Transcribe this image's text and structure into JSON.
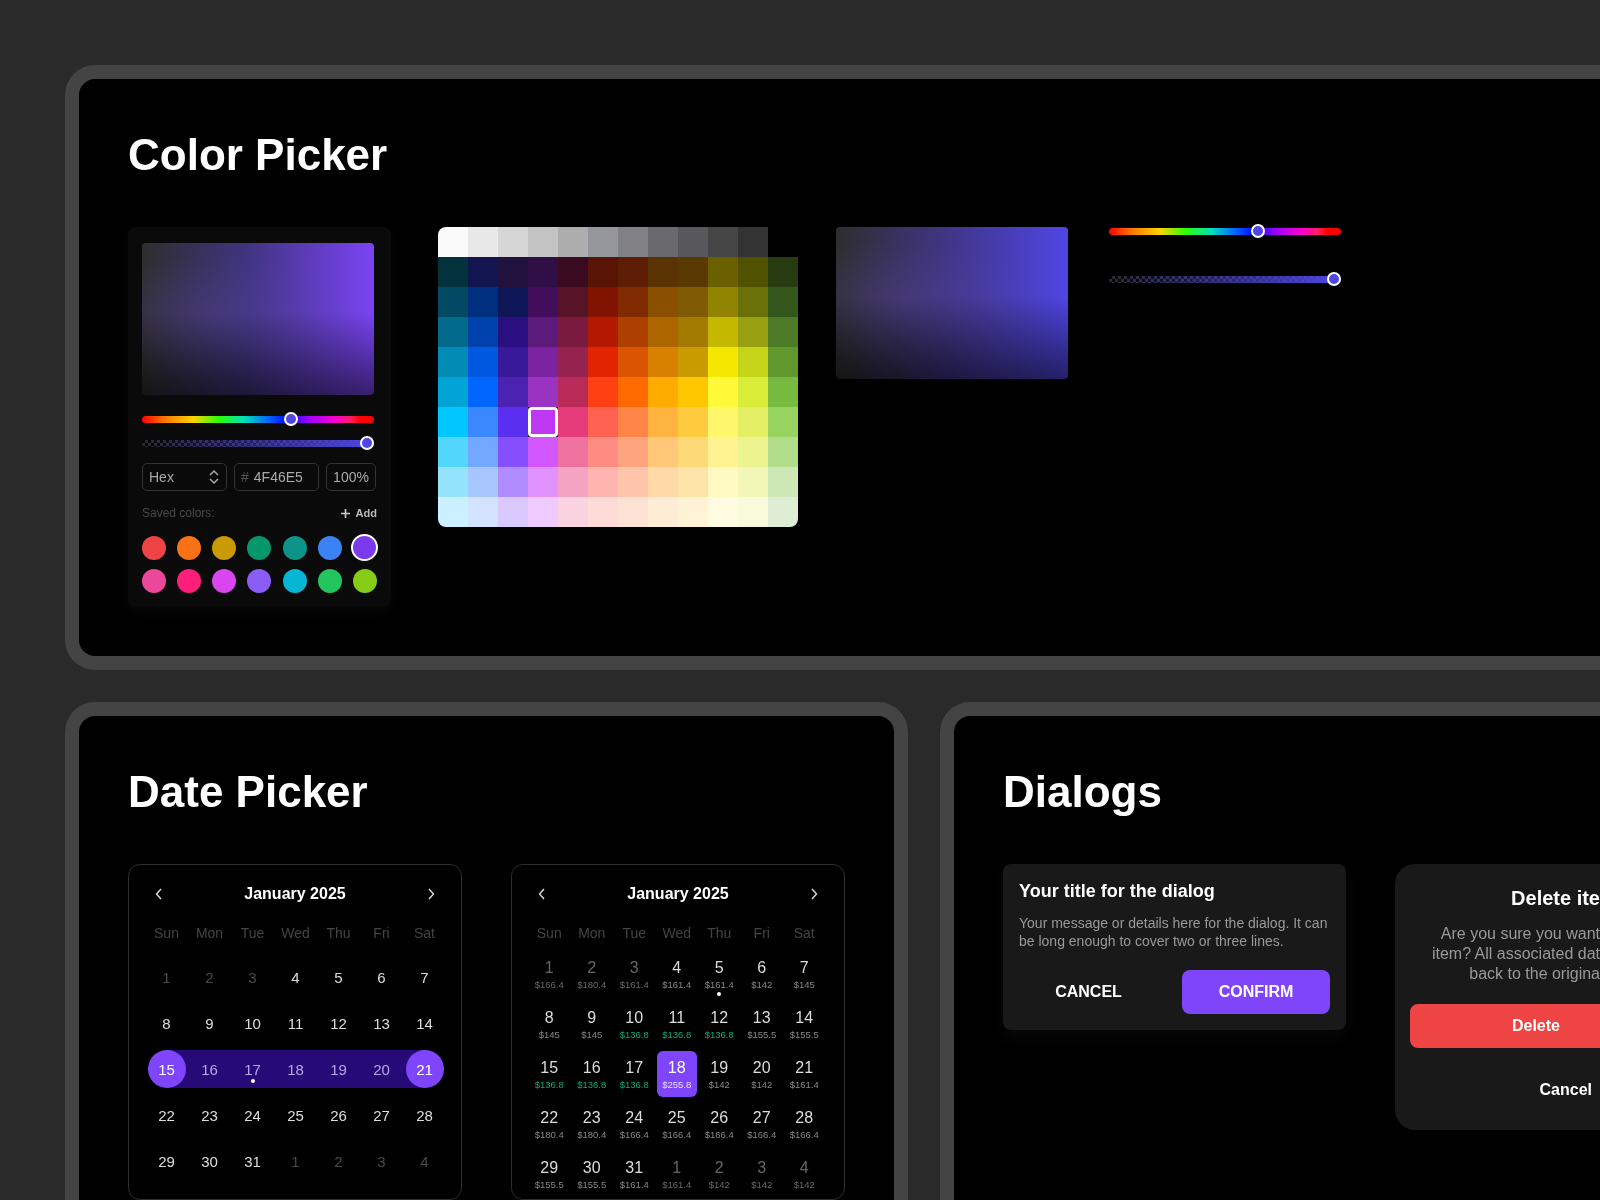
{
  "color_picker": {
    "title": "Color Picker",
    "picker_card": {
      "hue_slider": {
        "level": 0.65
      },
      "alpha_slider": {
        "level": 1
      },
      "format_select": {
        "value": "Hex"
      },
      "hex_field": {
        "prefix": "#",
        "value": "4F46E5"
      },
      "opacity_field": {
        "value": "100%"
      },
      "saved_label": "Saved colors:",
      "add_button": "Add",
      "saved_colors": [
        {
          "color": "#ef4444",
          "selected": false
        },
        {
          "color": "#f97316",
          "selected": false
        },
        {
          "color": "#ca9a04",
          "selected": false
        },
        {
          "color": "#059669",
          "selected": false
        },
        {
          "color": "#0d9488",
          "selected": false
        },
        {
          "color": "#3b82f6",
          "selected": false
        },
        {
          "color": "#7c3aed",
          "selected": true
        },
        {
          "color": "#ec4899",
          "selected": false
        },
        {
          "color": "#ff1f7a",
          "selected": false
        },
        {
          "color": "#d946ef",
          "selected": false
        },
        {
          "color": "#8b5cf6",
          "selected": false
        },
        {
          "color": "#06b6d4",
          "selected": false
        },
        {
          "color": "#22c55e",
          "selected": false
        },
        {
          "color": "#84cc16",
          "selected": false
        }
      ]
    },
    "palette": {
      "rows": [
        {
          "cells": [
            {
              "color": "#fafafa",
              "selected": false
            },
            {
              "color": "#e8e8e8",
              "selected": false
            },
            {
              "color": "#d6d6d6",
              "selected": false
            },
            {
              "color": "#c4c4c4",
              "selected": false
            },
            {
              "color": "#adadad",
              "selected": false
            },
            {
              "color": "#95969c",
              "selected": false
            },
            {
              "color": "#808085",
              "selected": false
            },
            {
              "color": "#6a6a6e",
              "selected": false
            },
            {
              "color": "#58585c",
              "selected": false
            },
            {
              "color": "#454545",
              "selected": false
            },
            {
              "color": "#333333",
              "selected": false
            }
          ]
        },
        {
          "cells": [
            {
              "color": "#04323d",
              "selected": false
            },
            {
              "color": "#121550",
              "selected": false
            },
            {
              "color": "#21113d",
              "selected": false
            },
            {
              "color": "#2f0f45",
              "selected": false
            },
            {
              "color": "#3a0a20",
              "selected": false
            },
            {
              "color": "#5a1405",
              "selected": false
            },
            {
              "color": "#5e1e05",
              "selected": false
            },
            {
              "color": "#5a3302",
              "selected": false
            },
            {
              "color": "#5a3a02",
              "selected": false
            },
            {
              "color": "#6a6000",
              "selected": false
            },
            {
              "color": "#515200",
              "selected": false
            },
            {
              "color": "#263c10",
              "selected": false
            }
          ]
        },
        {
          "cells": [
            {
              "color": "#024a63",
              "selected": false
            },
            {
              "color": "#012f7f",
              "selected": false
            },
            {
              "color": "#101758",
              "selected": false
            },
            {
              "color": "#420e5c",
              "selected": false
            },
            {
              "color": "#571429",
              "selected": false
            },
            {
              "color": "#801400",
              "selected": false
            },
            {
              "color": "#7f2a00",
              "selected": false
            },
            {
              "color": "#8a5000",
              "selected": false
            },
            {
              "color": "#7f5c04",
              "selected": false
            },
            {
              "color": "#8f8300",
              "selected": false
            },
            {
              "color": "#6a7109",
              "selected": false
            },
            {
              "color": "#34561b",
              "selected": false
            }
          ]
        },
        {
          "cells": [
            {
              "color": "#026a8a",
              "selected": false
            },
            {
              "color": "#0042ab",
              "selected": false
            },
            {
              "color": "#2a0f80",
              "selected": false
            },
            {
              "color": "#5c1a7a",
              "selected": false
            },
            {
              "color": "#7a1a3e",
              "selected": false
            },
            {
              "color": "#b31900",
              "selected": false
            },
            {
              "color": "#ad3f00",
              "selected": false
            },
            {
              "color": "#ad6500",
              "selected": false
            },
            {
              "color": "#a37a00",
              "selected": false
            },
            {
              "color": "#c4b800",
              "selected": false
            },
            {
              "color": "#9aa111",
              "selected": false
            },
            {
              "color": "#4c7a26",
              "selected": false
            }
          ]
        },
        {
          "cells": [
            {
              "color": "#028bb5",
              "selected": false
            },
            {
              "color": "#0057e0",
              "selected": false
            },
            {
              "color": "#361a99",
              "selected": false
            },
            {
              "color": "#7a22a0",
              "selected": false
            },
            {
              "color": "#962250",
              "selected": false
            },
            {
              "color": "#e32400",
              "selected": false
            },
            {
              "color": "#db5400",
              "selected": false
            },
            {
              "color": "#d88100",
              "selected": false
            },
            {
              "color": "#c99b00",
              "selected": false
            },
            {
              "color": "#f5e800",
              "selected": false
            },
            {
              "color": "#c4d417",
              "selected": false
            },
            {
              "color": "#60982e",
              "selected": false
            }
          ]
        },
        {
          "cells": [
            {
              "color": "#00a5d6",
              "selected": false
            },
            {
              "color": "#0066ff",
              "selected": false
            },
            {
              "color": "#4c22b3",
              "selected": false
            },
            {
              "color": "#9b33c2",
              "selected": false
            },
            {
              "color": "#b82b58",
              "selected": false
            },
            {
              "color": "#ff4013",
              "selected": false
            },
            {
              "color": "#ff6a00",
              "selected": false
            },
            {
              "color": "#ffab00",
              "selected": false
            },
            {
              "color": "#fec700",
              "selected": false
            },
            {
              "color": "#fff93a",
              "selected": false
            },
            {
              "color": "#d9ec37",
              "selected": false
            },
            {
              "color": "#76bb40",
              "selected": false
            }
          ]
        },
        {
          "cells": [
            {
              "color": "#00c8ff",
              "selected": false
            },
            {
              "color": "#3a87fe",
              "selected": false
            },
            {
              "color": "#5b2ff0",
              "selected": false
            },
            {
              "color": "#be38f3",
              "selected": true
            },
            {
              "color": "#e63b7a",
              "selected": false
            },
            {
              "color": "#ff6250",
              "selected": false
            },
            {
              "color": "#ff8648",
              "selected": false
            },
            {
              "color": "#ffb43f",
              "selected": false
            },
            {
              "color": "#fecb3e",
              "selected": false
            },
            {
              "color": "#fff76b",
              "selected": false
            },
            {
              "color": "#e4ef65",
              "selected": false
            },
            {
              "color": "#96d35f",
              "selected": false
            }
          ]
        },
        {
          "cells": [
            {
              "color": "#52d6fc",
              "selected": false
            },
            {
              "color": "#74a7ff",
              "selected": false
            },
            {
              "color": "#864ffe",
              "selected": false
            },
            {
              "color": "#d357fe",
              "selected": false
            },
            {
              "color": "#ee719e",
              "selected": false
            },
            {
              "color": "#ff8c82",
              "selected": false
            },
            {
              "color": "#ffa57d",
              "selected": false
            },
            {
              "color": "#ffc777",
              "selected": false
            },
            {
              "color": "#fed977",
              "selected": false
            },
            {
              "color": "#fff291",
              "selected": false
            },
            {
              "color": "#ebf48f",
              "selected": false
            },
            {
              "color": "#b1dd8b",
              "selected": false
            }
          ]
        },
        {
          "cells": [
            {
              "color": "#93e3fd",
              "selected": false
            },
            {
              "color": "#a7c6ff",
              "selected": false
            },
            {
              "color": "#b18cfe",
              "selected": false
            },
            {
              "color": "#e292fe",
              "selected": false
            },
            {
              "color": "#f4a4c0",
              "selected": false
            },
            {
              "color": "#ffb5af",
              "selected": false
            },
            {
              "color": "#ffc5ab",
              "selected": false
            },
            {
              "color": "#ffd9a8",
              "selected": false
            },
            {
              "color": "#fee4a8",
              "selected": false
            },
            {
              "color": "#fff9c2",
              "selected": false
            },
            {
              "color": "#f2f7b7",
              "selected": false
            },
            {
              "color": "#cde8b5",
              "selected": false
            }
          ]
        },
        {
          "cells": [
            {
              "color": "#cbf0ff",
              "selected": false
            },
            {
              "color": "#d3e2ff",
              "selected": false
            },
            {
              "color": "#d9c9fe",
              "selected": false
            },
            {
              "color": "#efcaff",
              "selected": false
            },
            {
              "color": "#f9d3e0",
              "selected": false
            },
            {
              "color": "#ffdbd8",
              "selected": false
            },
            {
              "color": "#ffe2d6",
              "selected": false
            },
            {
              "color": "#ffecd4",
              "selected": false
            },
            {
              "color": "#fff2d5",
              "selected": false
            },
            {
              "color": "#fffbe0",
              "selected": false
            },
            {
              "color": "#f7fadb",
              "selected": false
            },
            {
              "color": "#dfedd4",
              "selected": false
            }
          ]
        }
      ]
    },
    "hue_slider": {
      "level": 0.65
    },
    "alpha_slider": {
      "level": 1
    }
  },
  "date_picker": {
    "title": "Date Picker",
    "calendars": [
      {
        "kind": "range",
        "month": "January 2025",
        "weekdays": [
          "Sun",
          "Mon",
          "Tue",
          "Wed",
          "Thu",
          "Fri",
          "Sat"
        ],
        "days": [
          {
            "day": "1",
            "muted": true,
            "selected": false,
            "in_range": false,
            "marked": false
          },
          {
            "day": "2",
            "muted": true,
            "selected": false,
            "in_range": false,
            "marked": false
          },
          {
            "day": "3",
            "muted": true,
            "selected": false,
            "in_range": false,
            "marked": false
          },
          {
            "day": "4",
            "muted": false,
            "selected": false,
            "in_range": false,
            "marked": false
          },
          {
            "day": "5",
            "muted": false,
            "selected": false,
            "in_range": false,
            "marked": false
          },
          {
            "day": "6",
            "muted": false,
            "selected": false,
            "in_range": false,
            "marked": false
          },
          {
            "day": "7",
            "muted": false,
            "selected": false,
            "in_range": false,
            "marked": false
          },
          {
            "day": "8",
            "muted": false,
            "selected": false,
            "in_range": false,
            "marked": false
          },
          {
            "day": "9",
            "muted": false,
            "selected": false,
            "in_range": false,
            "marked": false
          },
          {
            "day": "10",
            "muted": false,
            "selected": false,
            "in_range": false,
            "marked": false
          },
          {
            "day": "11",
            "muted": false,
            "selected": false,
            "in_range": false,
            "marked": false
          },
          {
            "day": "12",
            "muted": false,
            "selected": false,
            "in_range": false,
            "marked": false
          },
          {
            "day": "13",
            "muted": false,
            "selected": false,
            "in_range": false,
            "marked": false
          },
          {
            "day": "14",
            "muted": false,
            "selected": false,
            "in_range": false,
            "marked": false
          },
          {
            "day": "15",
            "muted": false,
            "selected": true,
            "in_range": false,
            "marked": false
          },
          {
            "day": "16",
            "muted": false,
            "selected": false,
            "in_range": true,
            "marked": false
          },
          {
            "day": "17",
            "muted": false,
            "selected": false,
            "in_range": true,
            "marked": true
          },
          {
            "day": "18",
            "muted": false,
            "selected": false,
            "in_range": true,
            "marked": false
          },
          {
            "day": "19",
            "muted": false,
            "selected": false,
            "in_range": true,
            "marked": false
          },
          {
            "day": "20",
            "muted": false,
            "selected": false,
            "in_range": true,
            "marked": false
          },
          {
            "day": "21",
            "muted": false,
            "selected": true,
            "in_range": false,
            "marked": false
          },
          {
            "day": "22",
            "muted": false,
            "selected": false,
            "in_range": false,
            "marked": false
          },
          {
            "day": "23",
            "muted": false,
            "selected": false,
            "in_range": false,
            "marked": false
          },
          {
            "day": "24",
            "muted": false,
            "selected": false,
            "in_range": false,
            "marked": false
          },
          {
            "day": "25",
            "muted": false,
            "selected": false,
            "in_range": false,
            "marked": false
          },
          {
            "day": "26",
            "muted": false,
            "selected": false,
            "in_range": false,
            "marked": false
          },
          {
            "day": "27",
            "muted": false,
            "selected": false,
            "in_range": false,
            "marked": false
          },
          {
            "day": "28",
            "muted": false,
            "selected": false,
            "in_range": false,
            "marked": false
          },
          {
            "day": "29",
            "muted": false,
            "selected": false,
            "in_range": false,
            "marked": false
          },
          {
            "day": "30",
            "muted": false,
            "selected": false,
            "in_range": false,
            "marked": false
          },
          {
            "day": "31",
            "muted": false,
            "selected": false,
            "in_range": false,
            "marked": false
          },
          {
            "day": "1",
            "muted": true,
            "selected": false,
            "in_range": false,
            "marked": false
          },
          {
            "day": "2",
            "muted": true,
            "selected": false,
            "in_range": false,
            "marked": false
          },
          {
            "day": "3",
            "muted": true,
            "selected": false,
            "in_range": false,
            "marked": false
          },
          {
            "day": "4",
            "muted": true,
            "selected": false,
            "in_range": false,
            "marked": false
          }
        ]
      },
      {
        "kind": "price",
        "month": "January 2025",
        "weekdays": [
          "Sun",
          "Mon",
          "Tue",
          "Wed",
          "Thu",
          "Fri",
          "Sat"
        ],
        "days": [
          {
            "day": "1",
            "price": "$166.4",
            "muted": true,
            "deal": false,
            "selected": false,
            "marked": false
          },
          {
            "day": "2",
            "price": "$180.4",
            "muted": true,
            "deal": false,
            "selected": false,
            "marked": false
          },
          {
            "day": "3",
            "price": "$161.4",
            "muted": true,
            "deal": false,
            "selected": false,
            "marked": false
          },
          {
            "day": "4",
            "price": "$161.4",
            "muted": false,
            "deal": false,
            "selected": false,
            "marked": false
          },
          {
            "day": "5",
            "price": "$161.4",
            "muted": false,
            "deal": false,
            "selected": false,
            "marked": true
          },
          {
            "day": "6",
            "price": "$142",
            "muted": false,
            "deal": false,
            "selected": false,
            "marked": false
          },
          {
            "day": "7",
            "price": "$145",
            "muted": false,
            "deal": false,
            "selected": false,
            "marked": false
          },
          {
            "day": "8",
            "price": "$145",
            "muted": false,
            "deal": false,
            "selected": false,
            "marked": false
          },
          {
            "day": "9",
            "price": "$145",
            "muted": false,
            "deal": false,
            "selected": false,
            "marked": false
          },
          {
            "day": "10",
            "price": "$136.8",
            "muted": false,
            "deal": true,
            "selected": false,
            "marked": false
          },
          {
            "day": "11",
            "price": "$136.8",
            "muted": false,
            "deal": true,
            "selected": false,
            "marked": false
          },
          {
            "day": "12",
            "price": "$136.8",
            "muted": false,
            "deal": true,
            "selected": false,
            "marked": false
          },
          {
            "day": "13",
            "price": "$155.5",
            "muted": false,
            "deal": false,
            "selected": false,
            "marked": false
          },
          {
            "day": "14",
            "price": "$155.5",
            "muted": false,
            "deal": false,
            "selected": false,
            "marked": false
          },
          {
            "day": "15",
            "price": "$136.8",
            "muted": false,
            "deal": true,
            "selected": false,
            "marked": false
          },
          {
            "day": "16",
            "price": "$136.8",
            "muted": false,
            "deal": true,
            "selected": false,
            "marked": false
          },
          {
            "day": "17",
            "price": "$136.8",
            "muted": false,
            "deal": true,
            "selected": false,
            "marked": false
          },
          {
            "day": "18",
            "price": "$255.8",
            "muted": false,
            "deal": false,
            "selected": true,
            "marked": false
          },
          {
            "day": "19",
            "price": "$142",
            "muted": false,
            "deal": false,
            "selected": false,
            "marked": false
          },
          {
            "day": "20",
            "price": "$142",
            "muted": false,
            "deal": false,
            "selected": false,
            "marked": false
          },
          {
            "day": "21",
            "price": "$161.4",
            "muted": false,
            "deal": false,
            "selected": false,
            "marked": false
          },
          {
            "day": "22",
            "price": "$180.4",
            "muted": false,
            "deal": false,
            "selected": false,
            "marked": false
          },
          {
            "day": "23",
            "price": "$180.4",
            "muted": false,
            "deal": false,
            "selected": false,
            "marked": false
          },
          {
            "day": "24",
            "price": "$166.4",
            "muted": false,
            "deal": false,
            "selected": false,
            "marked": false
          },
          {
            "day": "25",
            "price": "$166.4",
            "muted": false,
            "deal": false,
            "selected": false,
            "marked": false
          },
          {
            "day": "26",
            "price": "$166.4",
            "muted": false,
            "deal": false,
            "selected": false,
            "marked": false
          },
          {
            "day": "27",
            "price": "$166.4",
            "muted": false,
            "deal": false,
            "selected": false,
            "marked": false
          },
          {
            "day": "28",
            "price": "$166.4",
            "muted": false,
            "deal": false,
            "selected": false,
            "marked": false
          },
          {
            "day": "29",
            "price": "$155.5",
            "muted": false,
            "deal": false,
            "selected": false,
            "marked": false
          },
          {
            "day": "30",
            "price": "$155.5",
            "muted": false,
            "deal": false,
            "selected": false,
            "marked": false
          },
          {
            "day": "31",
            "price": "$161.4",
            "muted": false,
            "deal": false,
            "selected": false,
            "marked": false
          },
          {
            "day": "1",
            "price": "$161.4",
            "muted": true,
            "deal": false,
            "selected": false,
            "marked": false
          },
          {
            "day": "2",
            "price": "$142",
            "muted": true,
            "deal": false,
            "selected": false,
            "marked": false
          },
          {
            "day": "3",
            "price": "$142",
            "muted": true,
            "deal": false,
            "selected": false,
            "marked": false
          },
          {
            "day": "4",
            "price": "$142",
            "muted": true,
            "deal": false,
            "selected": false,
            "marked": false
          }
        ]
      }
    ]
  },
  "dialogs": {
    "title": "Dialogs",
    "items": [
      {
        "kind": "confirm",
        "title": "Your title for the dialog",
        "message_lines": [
          "Your message or details here for the dialog. It can be long enough to cover two or three lines."
        ],
        "buttons": [
          {
            "kind": "text",
            "label": "CANCEL"
          },
          {
            "kind": "primary",
            "label": "CONFIRM"
          }
        ]
      },
      {
        "kind": "destructive",
        "title": "Delete ite",
        "message_lines": [
          "Are you sure you want",
          "item? All associated dat",
          "back to the origina"
        ],
        "buttons": [
          {
            "kind": "danger",
            "label": "Delete"
          },
          {
            "kind": "text",
            "label": "Cancel"
          }
        ]
      }
    ]
  }
}
